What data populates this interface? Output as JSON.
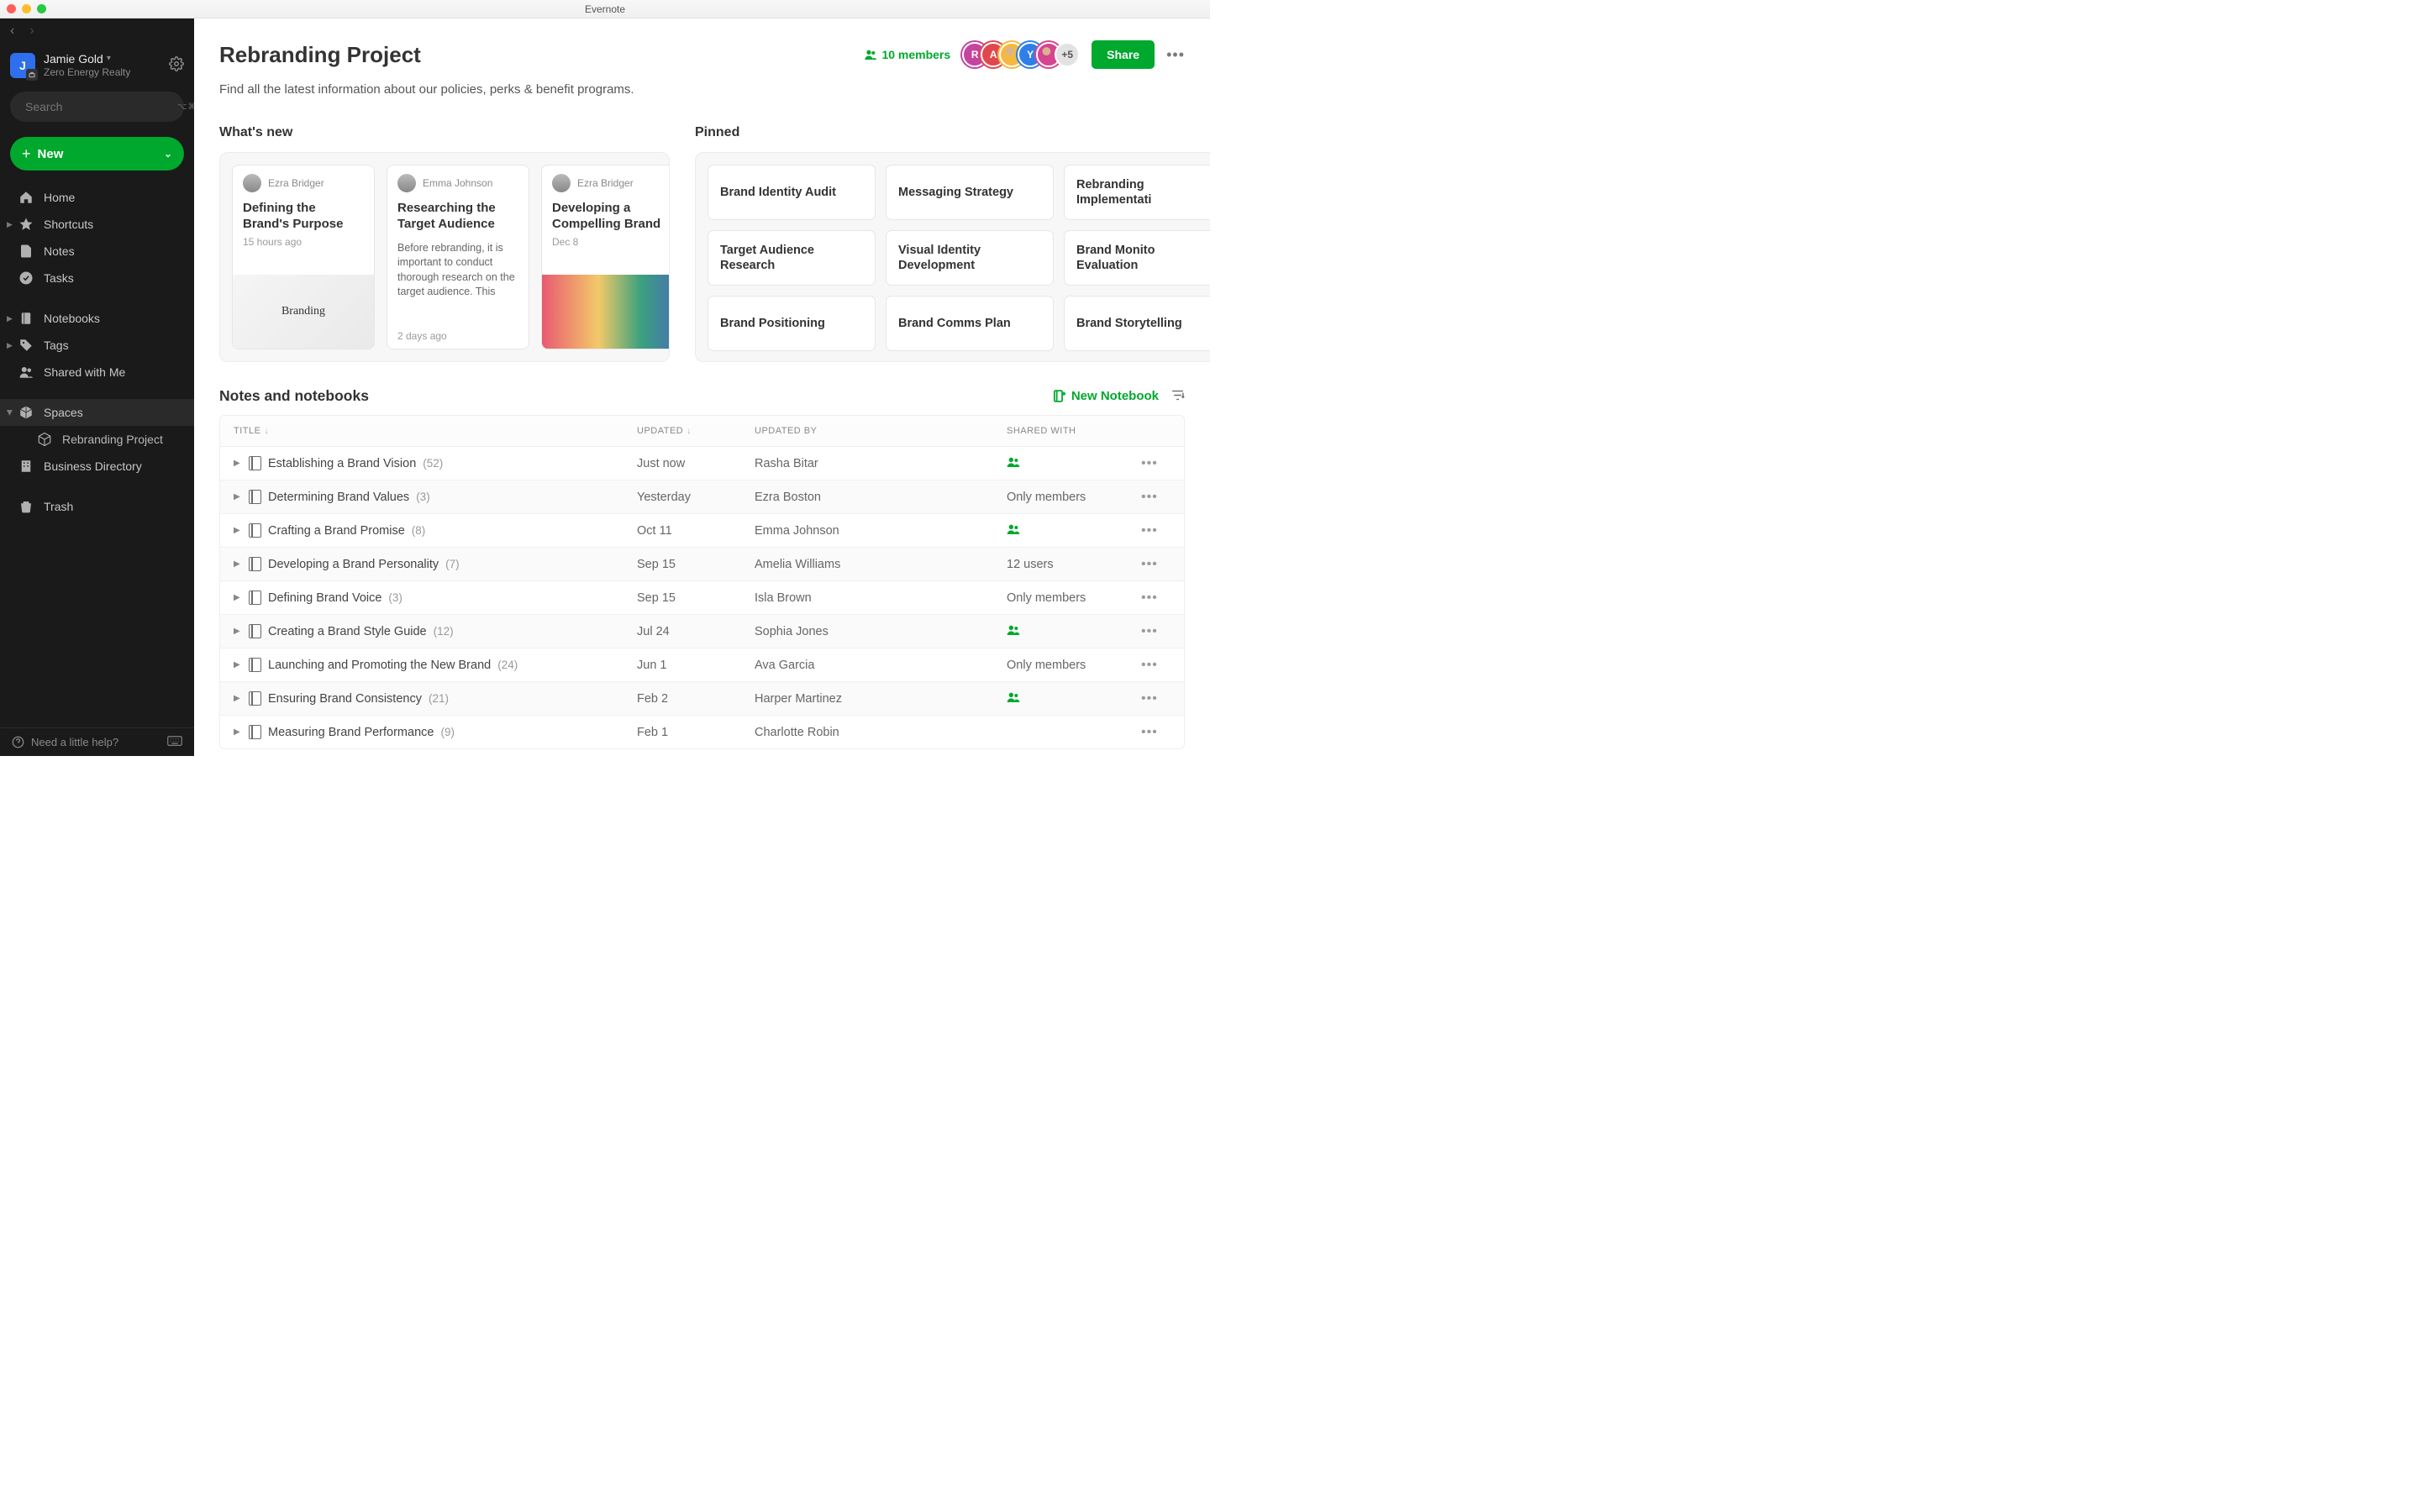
{
  "app": {
    "window_title": "Evernote"
  },
  "sidebar": {
    "account": {
      "initial": "J",
      "name": "Jamie Gold",
      "org": "Zero Energy Realty"
    },
    "search": {
      "placeholder": "Search",
      "shortcut": "⌥⌘F"
    },
    "new_label": "New",
    "nav": {
      "home": "Home",
      "shortcuts": "Shortcuts",
      "notes": "Notes",
      "tasks": "Tasks",
      "notebooks": "Notebooks",
      "tags": "Tags",
      "shared": "Shared with Me",
      "spaces": "Spaces",
      "rebranding": "Rebranding Project",
      "bizdir": "Business Directory",
      "trash": "Trash"
    },
    "help": "Need a little help?"
  },
  "header": {
    "title": "Rebranding Project",
    "members_count": "10 members",
    "avatars": [
      {
        "letter": "R",
        "color": "#c445a0"
      },
      {
        "letter": "A",
        "color": "#e0484d"
      },
      {
        "letter": "",
        "color": "#f5b942",
        "img": true
      },
      {
        "letter": "Y",
        "color": "#2f7fe8"
      },
      {
        "letter": "",
        "color": "#d64590",
        "img": true
      }
    ],
    "avatars_more": "+5",
    "share_label": "Share"
  },
  "subtitle": "Find all the latest information about our policies, perks & benefit programs.",
  "whatsnew": {
    "title": "What's new",
    "cards": [
      {
        "author": "Ezra Bridger",
        "title": "Defining the Brand's Purpose",
        "body": "",
        "meta": "15 hours ago",
        "img": "branding"
      },
      {
        "author": "Emma Johnson",
        "title": "Researching the Target Audience",
        "body": "Before rebranding, it is important to conduct thorough research on the target audience. This",
        "meta": "2 days ago",
        "img": ""
      },
      {
        "author": "Ezra Bridger",
        "title": "Developing a Compelling Brand",
        "body": "",
        "meta": "Dec 8",
        "img": "people"
      }
    ]
  },
  "pinned": {
    "title": "Pinned",
    "items": [
      "Brand Identity Audit",
      "Messaging Strategy",
      "Rebranding Implementati",
      "Target Audience Research",
      "Visual Identity Development",
      "Brand Monito Evaluation",
      "Brand Positioning",
      "Brand Comms Plan",
      "Brand Storytelling"
    ]
  },
  "table": {
    "title": "Notes and notebooks",
    "new_notebook": "New Notebook",
    "columns": {
      "title": "TITLE",
      "updated": "UPDATED",
      "by": "UPDATED BY",
      "shared": "SHARED WITH"
    },
    "rows": [
      {
        "title": "Establishing a Brand Vision",
        "count": "(52)",
        "updated": "Just now",
        "by": "Rasha Bitar",
        "shared": "icon"
      },
      {
        "title": "Determining Brand Values",
        "count": "(3)",
        "updated": "Yesterday",
        "by": "Ezra Boston",
        "shared": "Only members"
      },
      {
        "title": "Crafting a Brand Promise",
        "count": "(8)",
        "updated": "Oct 11",
        "by": "Emma Johnson",
        "shared": "icon"
      },
      {
        "title": "Developing a Brand Personality",
        "count": "(7)",
        "updated": "Sep 15",
        "by": "Amelia Williams",
        "shared": "12 users"
      },
      {
        "title": "Defining Brand Voice",
        "count": "(3)",
        "updated": "Sep 15",
        "by": "Isla Brown",
        "shared": "Only members"
      },
      {
        "title": "Creating a Brand Style Guide",
        "count": "(12)",
        "updated": "Jul 24",
        "by": "Sophia Jones",
        "shared": "icon"
      },
      {
        "title": "Launching and Promoting the New Brand",
        "count": "(24)",
        "updated": "Jun 1",
        "by": "Ava Garcia",
        "shared": "Only members"
      },
      {
        "title": "Ensuring Brand Consistency",
        "count": "(21)",
        "updated": "Feb 2",
        "by": "Harper Martinez",
        "shared": "icon"
      },
      {
        "title": "Measuring Brand Performance",
        "count": "(9)",
        "updated": "Feb 1",
        "by": "Charlotte Robin",
        "shared": ""
      }
    ]
  }
}
